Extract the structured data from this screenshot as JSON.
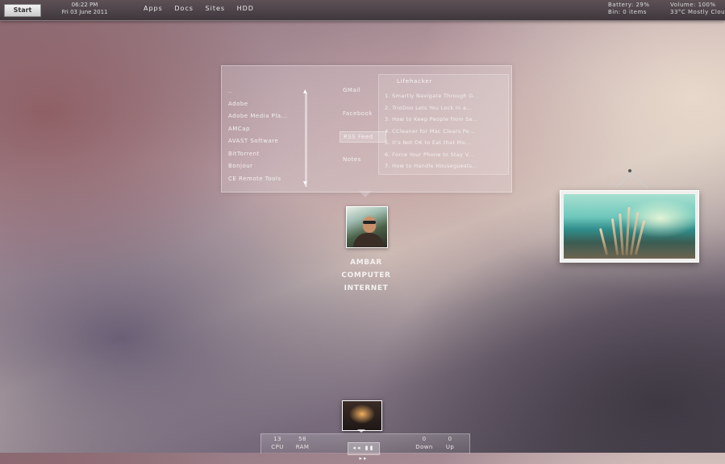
{
  "topbar": {
    "start_label": "Start",
    "time": "06:22 PM",
    "date": "Fri 03 June 2011",
    "nav": [
      "Apps",
      "Docs",
      "Sites",
      "HDD"
    ],
    "battery": "Battery: 29%",
    "bin": "Bin: 0 items",
    "volume": "Volume: 100%",
    "weather": "33°C Mostly Clou"
  },
  "launcher": {
    "apps": [
      "..",
      "Adobe",
      "Adobe Media Pla...",
      "AMCap",
      "AVAST Software",
      "BitTorrent",
      "Bonjour",
      "CE Remote Tools"
    ],
    "scroll_up": "▲",
    "scroll_down": "▼",
    "tabs": [
      "GMail",
      "Facebook",
      "RSS Feed",
      "Notes"
    ],
    "active_tab": "RSS Feed",
    "feed_title": "Lifehacker",
    "feed_items": [
      "1. Smartly Navigate Through G...",
      "2. TrioDoo Lets You Lock In a...",
      "3. How to Keep People from Se...",
      "4. CCleaner for Mac Clears Pe...",
      "5. It's Not OK to Eat that Mo...",
      "6. Force Your Phone to Stay V...",
      "7. How to Handle Houseguests..."
    ]
  },
  "profile": {
    "lines": [
      "AMBAR",
      "COMPUTER",
      "INTERNET"
    ]
  },
  "bottombar": {
    "cpu_value": "13",
    "cpu_label": "CPU",
    "ram_value": "58",
    "ram_label": "RAM",
    "down_value": "0",
    "down_label": "Down",
    "up_value": "0",
    "up_label": "Up",
    "media_controls": "◂◂ ▮▮ ▸▸"
  },
  "colors": {
    "bar_dark": "#3f373c",
    "panel_text": "#f4f0f0"
  }
}
